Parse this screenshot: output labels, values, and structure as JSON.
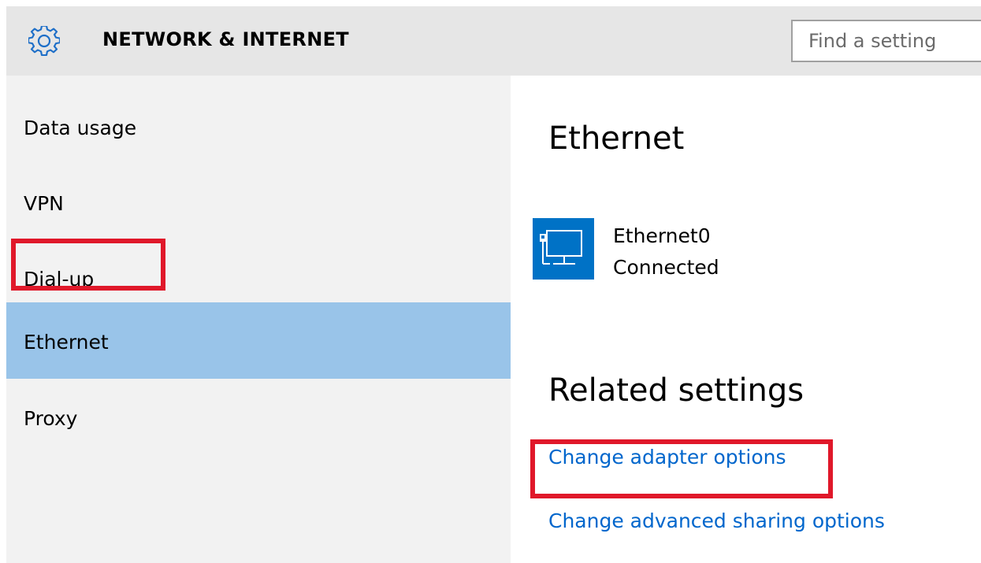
{
  "header": {
    "title": "NETWORK & INTERNET",
    "search_placeholder": "Find a setting",
    "icon": "gear-icon"
  },
  "sidebar": {
    "items": [
      {
        "label": "Data usage",
        "selected": false
      },
      {
        "label": "VPN",
        "selected": false
      },
      {
        "label": "Dial-up",
        "selected": false
      },
      {
        "label": "Ethernet",
        "selected": true
      },
      {
        "label": "Proxy",
        "selected": false
      }
    ]
  },
  "main": {
    "title": "Ethernet",
    "connection": {
      "icon": "ethernet-icon",
      "name": "Ethernet0",
      "status": "Connected"
    },
    "related": {
      "title": "Related settings",
      "links": [
        {
          "label": "Change adapter options",
          "highlighted": true
        },
        {
          "label": "Change advanced sharing options",
          "highlighted": false
        }
      ]
    }
  },
  "colors": {
    "header_bg": "#e6e6e6",
    "sidebar_bg": "#f2f2f2",
    "selected_bg": "#99c4e9",
    "accent_tile": "#0072c6",
    "link": "#0066cc",
    "highlight_border": "#e0182a"
  }
}
